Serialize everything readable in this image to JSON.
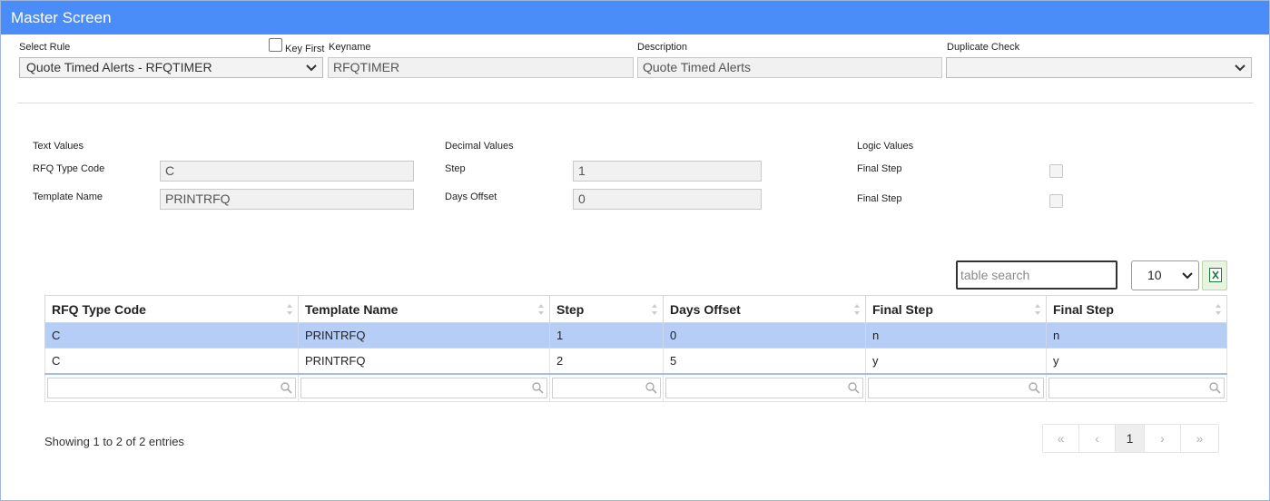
{
  "window": {
    "title": "Master Screen"
  },
  "header_form": {
    "select_rule_label": "Select Rule",
    "select_rule_value": "Quote Timed Alerts - RFQTIMER",
    "key_first_label": "Key First",
    "keyname_label": "Keyname",
    "keyname_value": "RFQTIMER",
    "description_label": "Description",
    "description_value": "Quote Timed Alerts",
    "duplicate_check_label": "Duplicate Check",
    "duplicate_check_value": ""
  },
  "text_values": {
    "heading": "Text Values",
    "fields": [
      {
        "label": "RFQ Type Code",
        "value": "C"
      },
      {
        "label": "Template Name",
        "value": "PRINTRFQ"
      }
    ]
  },
  "decimal_values": {
    "heading": "Decimal Values",
    "fields": [
      {
        "label": "Step",
        "value": "1"
      },
      {
        "label": "Days Offset",
        "value": "0"
      }
    ]
  },
  "logic_values": {
    "heading": "Logic Values",
    "fields": [
      {
        "label": "Final Step",
        "checked": false
      },
      {
        "label": "Final Step",
        "checked": false
      }
    ]
  },
  "table_controls": {
    "search_placeholder": "table search",
    "page_length": "10"
  },
  "table": {
    "columns": [
      "RFQ Type Code",
      "Template Name",
      "Step",
      "Days Offset",
      "Final Step",
      "Final Step"
    ],
    "rows": [
      [
        "C",
        "PRINTRFQ",
        "1",
        "0",
        "n",
        "n"
      ],
      [
        "C",
        "PRINTRFQ",
        "2",
        "5",
        "y",
        "y"
      ]
    ],
    "selected_row": 0
  },
  "footer": {
    "info": "Showing 1 to 2 of 2 entries",
    "pager": {
      "first": "«",
      "prev": "‹",
      "current": "1",
      "next": "›",
      "last": "»"
    }
  },
  "colors": {
    "titlebar": "#4a8df8",
    "selected_row": "#b6cdf5",
    "excel_icon": "#1e7a3c"
  }
}
